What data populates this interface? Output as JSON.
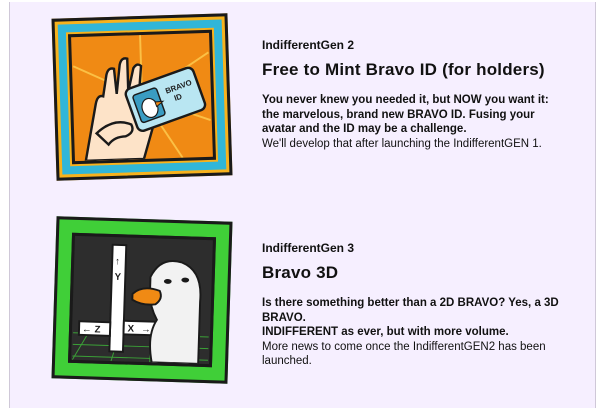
{
  "cards": [
    {
      "kicker": "IndifferentGen 2",
      "title": "Free to Mint Bravo ID (for holders)",
      "bold_lines": [
        "You never knew you needed it, but NOW you want it:",
        "the marvelous, brand new BRAVO ID. Fusing your",
        "avatar and the ID may be a challenge."
      ],
      "plain_lines": [
        "We'll develop that after launching the IndifferentGEN 1."
      ],
      "art": {
        "card_text_line1": "BRAVO",
        "card_text_line2": "ID"
      }
    },
    {
      "kicker": "IndifferentGen 3",
      "title": "Bravo 3D",
      "bold_lines": [
        "Is there something better than a 2D BRAVO? Yes, a 3D",
        "BRAVO.",
        "INDIFFERENT as ever, but with more volume."
      ],
      "plain_lines": [
        "More news to come once the IndifferentGEN2 has been",
        "launched."
      ],
      "art": {
        "axis_y": "Y",
        "axis_x": "X",
        "axis_z": "Z"
      }
    }
  ],
  "colors": {
    "panel_bg": "#f6efff",
    "frame1_orange": "#f7b21d",
    "frame1_blue": "#31b6d8",
    "frame2_green": "#40cf38"
  }
}
